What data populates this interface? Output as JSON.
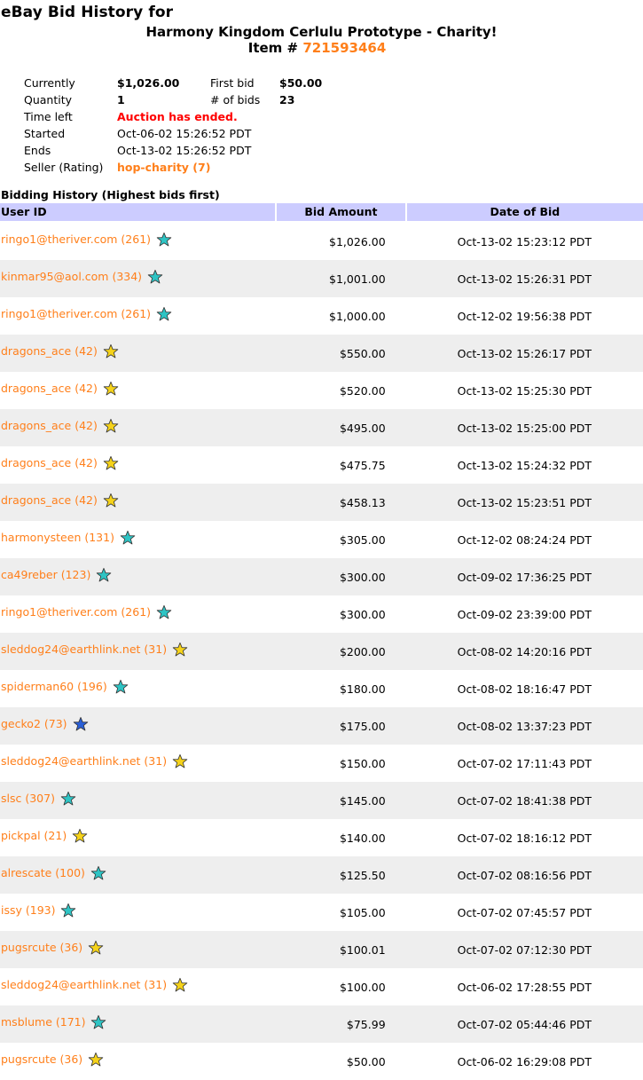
{
  "header": {
    "title_prefix": "eBay Bid History for",
    "item_title": "Harmony Kingdom Cerlulu Prototype - Charity!",
    "item_label": "Item #",
    "item_number": "721593464"
  },
  "summary": {
    "currently_label": "Currently",
    "currently_value": "$1,026.00",
    "first_bid_label": "First bid",
    "first_bid_value": "$50.00",
    "quantity_label": "Quantity",
    "quantity_value": "1",
    "num_bids_label": "# of bids",
    "num_bids_value": "23",
    "time_left_label": "Time left",
    "time_left_value": "Auction has ended.",
    "started_label": "Started",
    "started_value": "Oct-06-02 15:26:52 PDT",
    "ends_label": "Ends",
    "ends_value": "Oct-13-02 15:26:52 PDT",
    "seller_label": "Seller (Rating)",
    "seller_value": "hop-charity (7)"
  },
  "history": {
    "section_title": "Bidding History (Highest bids first)",
    "columns": [
      "User ID",
      "Bid Amount",
      "Date of Bid"
    ],
    "star_colors": {
      "turquoise": "#2ec4c4",
      "yellow": "#f5d21a",
      "blue": "#2a5fd6"
    },
    "link_color": "#ff7f1a",
    "header_bg": "#ccccff",
    "rows": [
      {
        "user": "ringo1@theriver.com (261)",
        "star": "turquoise",
        "amount": "$1,026.00",
        "date": "Oct-13-02 15:23:12 PDT"
      },
      {
        "user": "kinmar95@aol.com (334)",
        "star": "turquoise",
        "amount": "$1,001.00",
        "date": "Oct-13-02 15:26:31 PDT"
      },
      {
        "user": "ringo1@theriver.com (261)",
        "star": "turquoise",
        "amount": "$1,000.00",
        "date": "Oct-12-02 19:56:38 PDT"
      },
      {
        "user": "dragons_ace (42)",
        "star": "yellow",
        "amount": "$550.00",
        "date": "Oct-13-02 15:26:17 PDT"
      },
      {
        "user": "dragons_ace (42)",
        "star": "yellow",
        "amount": "$520.00",
        "date": "Oct-13-02 15:25:30 PDT"
      },
      {
        "user": "dragons_ace (42)",
        "star": "yellow",
        "amount": "$495.00",
        "date": "Oct-13-02 15:25:00 PDT"
      },
      {
        "user": "dragons_ace (42)",
        "star": "yellow",
        "amount": "$475.75",
        "date": "Oct-13-02 15:24:32 PDT"
      },
      {
        "user": "dragons_ace (42)",
        "star": "yellow",
        "amount": "$458.13",
        "date": "Oct-13-02 15:23:51 PDT"
      },
      {
        "user": "harmonysteen (131)",
        "star": "turquoise",
        "amount": "$305.00",
        "date": "Oct-12-02 08:24:24 PDT"
      },
      {
        "user": "ca49reber (123)",
        "star": "turquoise",
        "amount": "$300.00",
        "date": "Oct-09-02 17:36:25 PDT"
      },
      {
        "user": "ringo1@theriver.com (261)",
        "star": "turquoise",
        "amount": "$300.00",
        "date": "Oct-09-02 23:39:00 PDT"
      },
      {
        "user": "sleddog24@earthlink.net (31)",
        "star": "yellow",
        "amount": "$200.00",
        "date": "Oct-08-02 14:20:16 PDT"
      },
      {
        "user": "spiderman60 (196)",
        "star": "turquoise",
        "amount": "$180.00",
        "date": "Oct-08-02 18:16:47 PDT"
      },
      {
        "user": "gecko2 (73)",
        "star": "blue",
        "amount": "$175.00",
        "date": "Oct-08-02 13:37:23 PDT"
      },
      {
        "user": "sleddog24@earthlink.net (31)",
        "star": "yellow",
        "amount": "$150.00",
        "date": "Oct-07-02 17:11:43 PDT"
      },
      {
        "user": "slsc (307)",
        "star": "turquoise",
        "amount": "$145.00",
        "date": "Oct-07-02 18:41:38 PDT"
      },
      {
        "user": "pickpal (21)",
        "star": "yellow",
        "amount": "$140.00",
        "date": "Oct-07-02 18:16:12 PDT"
      },
      {
        "user": "alrescate (100)",
        "star": "turquoise",
        "amount": "$125.50",
        "date": "Oct-07-02 08:16:56 PDT"
      },
      {
        "user": "issy (193)",
        "star": "turquoise",
        "amount": "$105.00",
        "date": "Oct-07-02 07:45:57 PDT"
      },
      {
        "user": "pugsrcute (36)",
        "star": "yellow",
        "amount": "$100.01",
        "date": "Oct-07-02 07:12:30 PDT"
      },
      {
        "user": "sleddog24@earthlink.net (31)",
        "star": "yellow",
        "amount": "$100.00",
        "date": "Oct-06-02 17:28:55 PDT"
      },
      {
        "user": "msblume (171)",
        "star": "turquoise",
        "amount": "$75.99",
        "date": "Oct-07-02 05:44:46 PDT"
      },
      {
        "user": "pugsrcute (36)",
        "star": "yellow",
        "amount": "$50.00",
        "date": "Oct-06-02 16:29:08 PDT"
      }
    ]
  }
}
